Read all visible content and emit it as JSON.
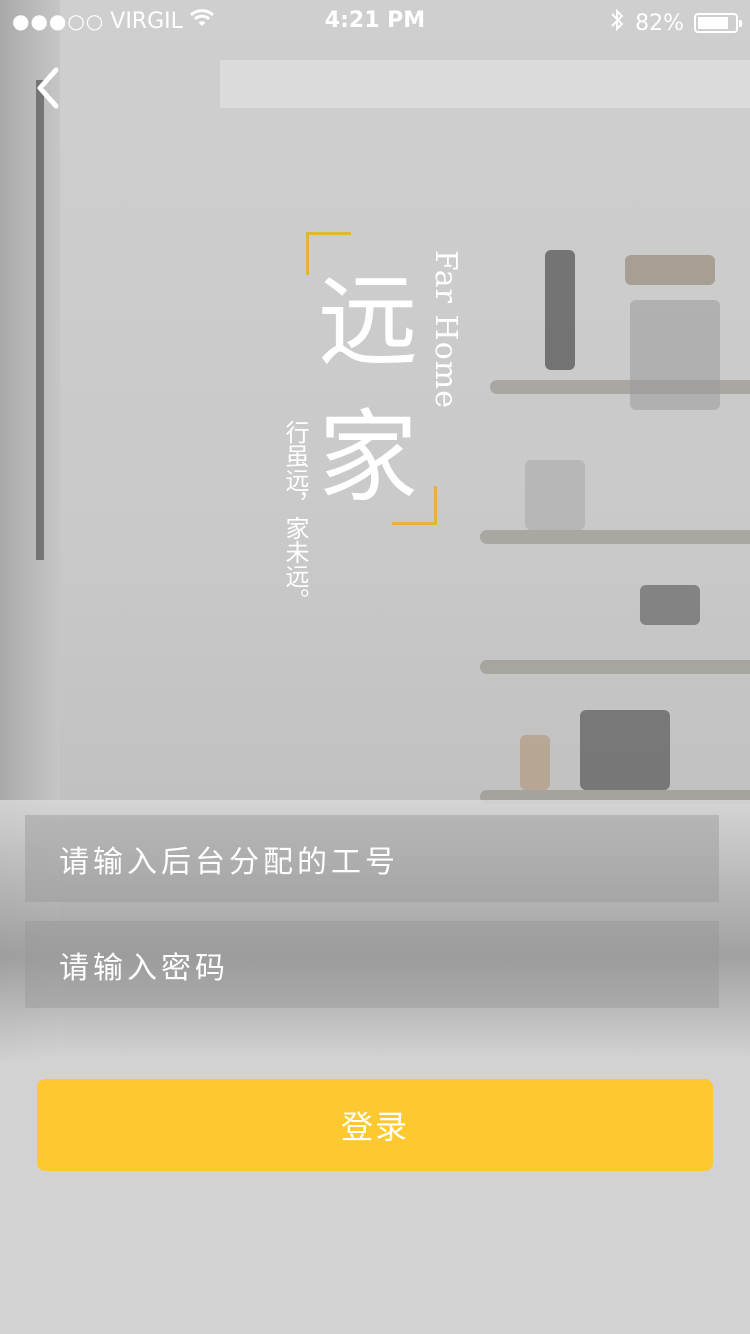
{
  "status_bar": {
    "signal_dots": "●●●○○",
    "carrier": "VIRGIL",
    "time": "4:21 PM",
    "battery": "82%",
    "battery_level": 0.82,
    "icons": [
      "wifi-icon",
      "bluetooth-icon",
      "battery-icon"
    ]
  },
  "nav": {
    "back_icon": "chevron-left-icon"
  },
  "logo": {
    "char_1": "远",
    "char_2": "家",
    "english": "Far Home",
    "slogan": "行虽远，家未远。",
    "accent_color": "#e2b437"
  },
  "form": {
    "employee_id_placeholder": "请输入后台分配的工号",
    "password_placeholder": "请输入密码",
    "login_label": "登录",
    "login_color": "#fdc830"
  }
}
